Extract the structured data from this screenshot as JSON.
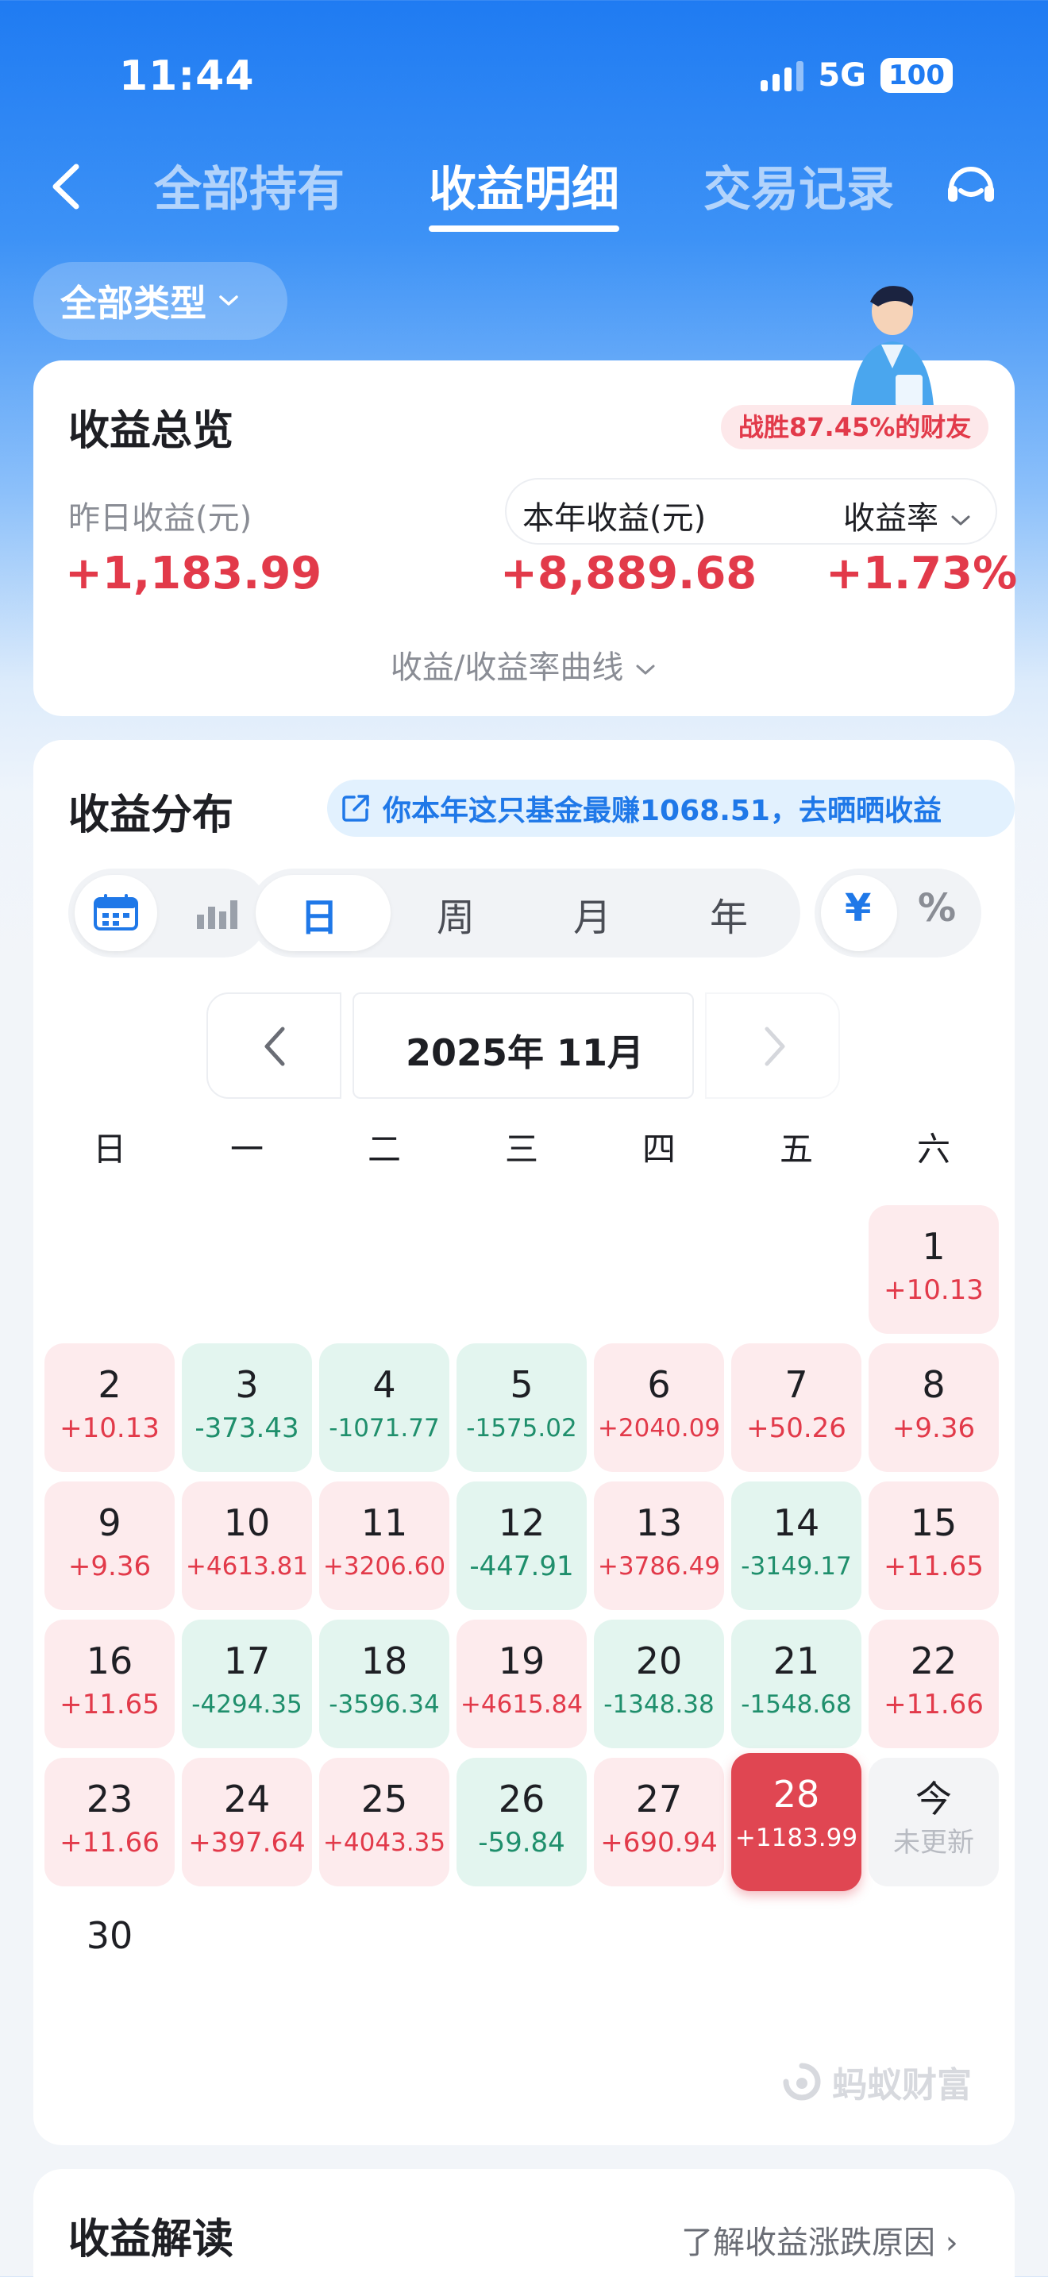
{
  "status": {
    "time": "11:44",
    "network": "5G",
    "battery": "100"
  },
  "nav": {
    "tabs": [
      "全部持有",
      "收益明细",
      "交易记录"
    ],
    "active_tab": "收益明细"
  },
  "filter": {
    "label": "全部类型"
  },
  "overview": {
    "title": "收益总览",
    "beat_badge": "战胜87.45%的财友",
    "yesterday_label": "昨日收益(元)",
    "yesterday_value": "+1,183.99",
    "year_label": "本年收益(元)",
    "year_value": "+8,889.68",
    "rate_label": "收益率",
    "rate_value": "+1.73%",
    "curve_toggle": "收益/收益率曲线"
  },
  "distribution": {
    "title": "收益分布",
    "share_banner": "你本年这只基金最赚1068.51，去晒晒收益",
    "periods": [
      "日",
      "周",
      "月",
      "年"
    ],
    "active_period": "日",
    "units": [
      "¥",
      "%"
    ],
    "active_unit": "¥",
    "month_label": "2025年 11月",
    "weekdays": [
      "日",
      "一",
      "二",
      "三",
      "四",
      "五",
      "六"
    ],
    "days": [
      {
        "d": "1",
        "v": "+10.13",
        "t": "pos"
      },
      {
        "d": "2",
        "v": "+10.13",
        "t": "pos"
      },
      {
        "d": "3",
        "v": "-373.43",
        "t": "neg"
      },
      {
        "d": "4",
        "v": "-1071.77",
        "t": "neg"
      },
      {
        "d": "5",
        "v": "-1575.02",
        "t": "neg"
      },
      {
        "d": "6",
        "v": "+2040.09",
        "t": "pos"
      },
      {
        "d": "7",
        "v": "+50.26",
        "t": "pos"
      },
      {
        "d": "8",
        "v": "+9.36",
        "t": "pos"
      },
      {
        "d": "9",
        "v": "+9.36",
        "t": "pos"
      },
      {
        "d": "10",
        "v": "+4613.81",
        "t": "pos"
      },
      {
        "d": "11",
        "v": "+3206.60",
        "t": "pos"
      },
      {
        "d": "12",
        "v": "-447.91",
        "t": "neg"
      },
      {
        "d": "13",
        "v": "+3786.49",
        "t": "pos"
      },
      {
        "d": "14",
        "v": "-3149.17",
        "t": "neg"
      },
      {
        "d": "15",
        "v": "+11.65",
        "t": "pos"
      },
      {
        "d": "16",
        "v": "+11.65",
        "t": "pos"
      },
      {
        "d": "17",
        "v": "-4294.35",
        "t": "neg"
      },
      {
        "d": "18",
        "v": "-3596.34",
        "t": "neg"
      },
      {
        "d": "19",
        "v": "+4615.84",
        "t": "pos"
      },
      {
        "d": "20",
        "v": "-1348.38",
        "t": "neg"
      },
      {
        "d": "21",
        "v": "-1548.68",
        "t": "neg"
      },
      {
        "d": "22",
        "v": "+11.66",
        "t": "pos"
      },
      {
        "d": "23",
        "v": "+11.66",
        "t": "pos"
      },
      {
        "d": "24",
        "v": "+397.64",
        "t": "pos"
      },
      {
        "d": "25",
        "v": "+4043.35",
        "t": "pos"
      },
      {
        "d": "26",
        "v": "-59.84",
        "t": "neg"
      },
      {
        "d": "27",
        "v": "+690.94",
        "t": "pos"
      },
      {
        "d": "28",
        "v": "+1183.99",
        "t": "sel"
      },
      {
        "d": "今",
        "v": "未更新",
        "t": "today"
      },
      {
        "d": "30",
        "v": "",
        "t": "plain"
      }
    ],
    "brand": "蚂蚁财富"
  },
  "interpret": {
    "title": "收益解读",
    "link": "了解收益涨跌原因 ›"
  },
  "colors": {
    "primary": "#1f7bf2",
    "gain": "#e23a4a",
    "loss": "#1f8f6c",
    "selected": "#e04652"
  }
}
